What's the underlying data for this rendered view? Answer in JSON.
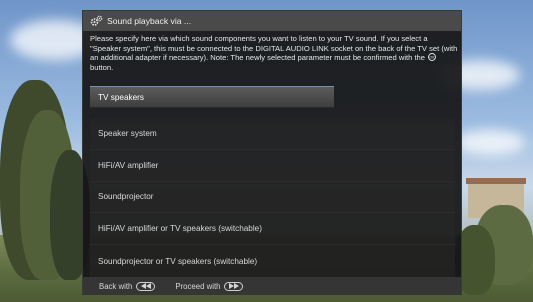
{
  "dialog": {
    "title": "Sound playback via ...",
    "description_before_icon": "Please specify here via which sound components you want to listen to your TV sound. If you select a \"Speaker system\", this must be connected to the DIGITAL AUDIO LINK socket on the back of the TV set (with an additional adapter if necessary). Note: The newly selected parameter must be confirmed with the",
    "description_after_icon": "button.",
    "options": [
      {
        "label": "TV speakers",
        "selected": true
      },
      {
        "label": "Speaker system",
        "selected": false
      },
      {
        "label": "HiFi/AV amplifier",
        "selected": false
      },
      {
        "label": "Soundprojector",
        "selected": false
      },
      {
        "label": "HiFi/AV amplifier or TV speakers (switchable)",
        "selected": false
      },
      {
        "label": "Soundprojector or TV speakers (switchable)",
        "selected": false
      }
    ],
    "footer": {
      "back_label": "Back with",
      "back_icon": "rewind-button-icon",
      "proceed_label": "Proceed with",
      "proceed_icon": "fast-forward-button-icon"
    }
  },
  "colors": {
    "dialog_bg": "#161616",
    "header_bg": "#4a4a4a",
    "selected_bg": "#5c5c5c",
    "text": "#e6e6e6"
  }
}
